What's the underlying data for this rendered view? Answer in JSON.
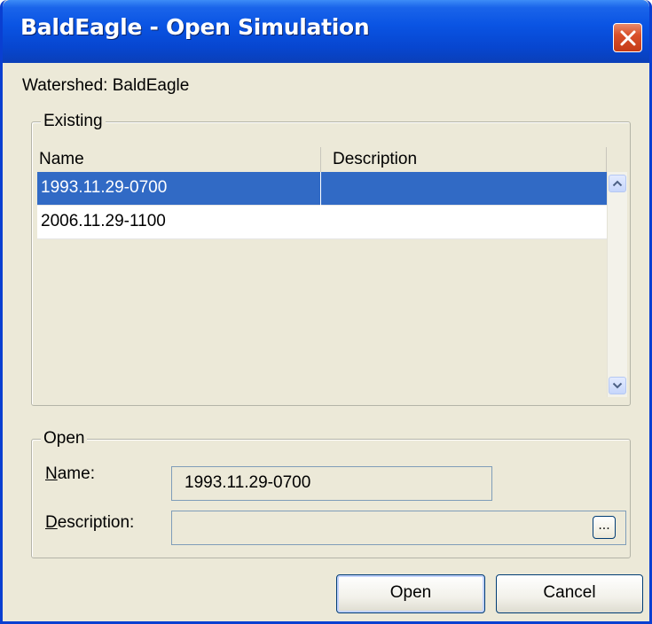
{
  "window": {
    "title": "BaldEagle - Open Simulation"
  },
  "watershed_label": "Watershed: BaldEagle",
  "existing": {
    "group_label": "Existing",
    "columns": [
      "Name",
      "Description"
    ],
    "rows": [
      {
        "name": "1993.11.29-0700",
        "description": "",
        "selected": true
      },
      {
        "name": "2006.11.29-1100",
        "description": "",
        "selected": false
      }
    ]
  },
  "open": {
    "group_label": "Open",
    "name_label_mnemonic": "N",
    "name_label_rest": "ame:",
    "name_value": "1993.11.29-0700",
    "description_label_mnemonic": "D",
    "description_label_rest": "escription:",
    "description_value": "",
    "ellipsis_label": "..."
  },
  "buttons": {
    "open_label": "Open",
    "cancel_label": "Cancel"
  },
  "colors": {
    "titlebar": "#0a54e3",
    "selection": "#316ac5",
    "window_bg": "#ece9d8",
    "close_button": "#d9502a"
  },
  "icons": {
    "close": "close-icon",
    "scroll_up": "chevron-up-icon",
    "scroll_down": "chevron-down-icon"
  }
}
